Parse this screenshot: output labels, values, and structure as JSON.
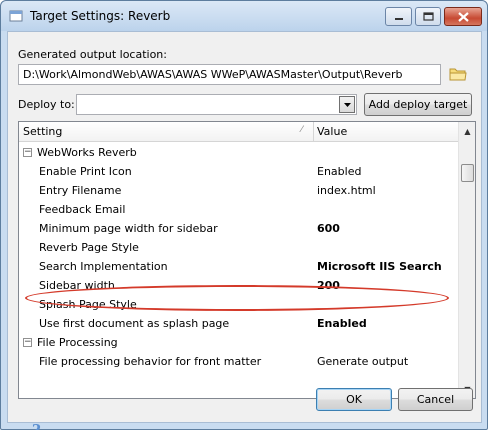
{
  "window": {
    "title": "Target Settings: Reverb",
    "minimize_icon": "minimize-icon",
    "maximize_icon": "maximize-icon",
    "close_icon": "close-icon"
  },
  "output_location": {
    "label": "Generated output location:",
    "value": "D:\\Work\\AlmondWeb\\AWAS\\AWAS WWeP\\AWASMaster\\Output\\Reverb",
    "browse_icon": "folder-icon"
  },
  "deploy": {
    "label": "Deploy to:",
    "selected": "",
    "add_button_label": "Add deploy target"
  },
  "grid": {
    "column_setting": "Setting",
    "column_value": "Value",
    "groups": [
      {
        "name": "WebWorks Reverb",
        "collapse_glyph": "−",
        "rows": [
          {
            "name": "Enable Print Icon",
            "value": "Enabled",
            "bold": false
          },
          {
            "name": "Entry Filename",
            "value": "index.html",
            "bold": false
          },
          {
            "name": "Feedback Email",
            "value": "",
            "bold": false
          },
          {
            "name": "Minimum page width for sidebar",
            "value": "600",
            "bold": true
          },
          {
            "name": "Reverb Page Style",
            "value": "",
            "bold": false
          },
          {
            "name": "Search Implementation",
            "value": "Microsoft IIS Search",
            "bold": true
          },
          {
            "name": "Sidebar width",
            "value": "200",
            "bold": true
          },
          {
            "name": "Splash Page Style",
            "value": "",
            "bold": false
          },
          {
            "name": "Use first document as splash page",
            "value": "Enabled",
            "bold": true
          }
        ]
      },
      {
        "name": "File Processing",
        "collapse_glyph": "−",
        "rows": [
          {
            "name": "File processing behavior for front matter",
            "value": "Generate output",
            "bold": false
          }
        ]
      }
    ]
  },
  "buttons": {
    "ok": "OK",
    "cancel": "Cancel"
  },
  "help_icon": "help-icon",
  "colors": {
    "highlight_ellipse": "#d43a2a"
  }
}
